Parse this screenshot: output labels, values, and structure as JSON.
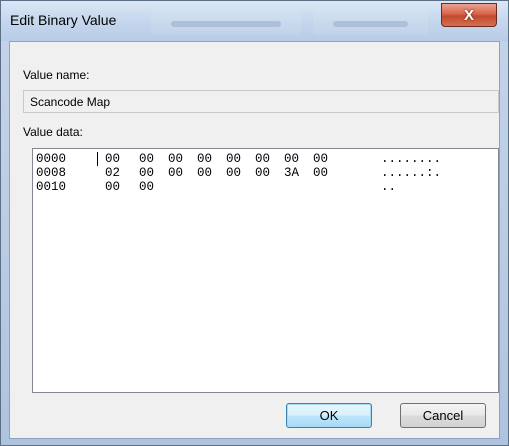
{
  "window": {
    "title": "Edit Binary Value",
    "close_symbol": "X"
  },
  "value_name": {
    "label": "Value name:",
    "value": "Scancode Map"
  },
  "value_data": {
    "label": "Value data:",
    "rows": [
      {
        "offset": "0000",
        "bytes": [
          "00",
          "00",
          "00",
          "00",
          "00",
          "00",
          "00",
          "00"
        ],
        "ascii": "........"
      },
      {
        "offset": "0008",
        "bytes": [
          "02",
          "00",
          "00",
          "00",
          "00",
          "00",
          "3A",
          "00"
        ],
        "ascii": "......:."
      },
      {
        "offset": "0010",
        "bytes": [
          "00",
          "00"
        ],
        "ascii": ".."
      }
    ]
  },
  "buttons": {
    "ok": "OK",
    "cancel": "Cancel"
  }
}
